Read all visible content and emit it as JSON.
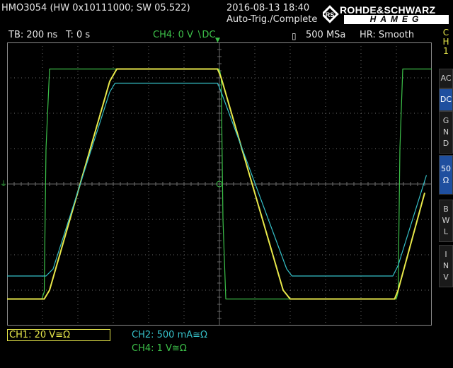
{
  "header": {
    "model_info": "HMO3054 (HW 0x10111000; SW 05.522)",
    "datetime": "2016-08-13 18:40",
    "status": "Auto-Trig./Complete",
    "brand_top": "ROHDE&SCHWARZ",
    "brand_bottom": "HAMEG"
  },
  "info_bar": {
    "timebase": "TB: 200 ns",
    "trigger_time": "T: 0 s",
    "trigger_channel": "CH4: 0 V ∖DC",
    "sample_rate": "500 MSa",
    "acq_mode": "HR: Smooth"
  },
  "side_menu": {
    "channel_label": [
      "C",
      "H",
      "1"
    ],
    "buttons": [
      {
        "id": "ac",
        "letters": [
          "AC"
        ],
        "active": false
      },
      {
        "id": "dc",
        "letters": [
          "DC"
        ],
        "active": true
      },
      {
        "id": "gnd",
        "letters": [
          "G",
          "N",
          "D"
        ],
        "active": false
      },
      {
        "id": "50ohm",
        "letters": [
          "50",
          "Ω"
        ],
        "active": true
      },
      {
        "id": "bwl",
        "letters": [
          "B",
          "W",
          "L"
        ],
        "active": false
      },
      {
        "id": "inv",
        "letters": [
          "I",
          "N",
          "V"
        ],
        "active": false
      }
    ]
  },
  "channels": {
    "ch1": "CH1: 20 V≅Ω",
    "ch2": "CH2: 500 mA≅Ω",
    "ch4": "CH4: 1 V≅Ω"
  },
  "colors": {
    "ch1": "#e8e84a",
    "ch2": "#35c0c8",
    "ch4": "#3dc24a",
    "grid": "#6a6a6a",
    "border": "#8a8a8a"
  },
  "markers": {
    "trigger_symbol": "▼",
    "ground_symbol": "⏚"
  },
  "chart_data": {
    "type": "line",
    "x_divisions": 12,
    "y_divisions": 8,
    "grid": true,
    "xlim": [
      -6,
      6
    ],
    "ylim": [
      -4,
      4
    ],
    "series": [
      {
        "name": "CH4",
        "color_key": "ch4",
        "x": [
          -6,
          -5.02,
          -4.95,
          -4.9,
          -4.8,
          0,
          0.05,
          0.1,
          0.18,
          5.0,
          5.05,
          5.1,
          5.18,
          6
        ],
        "y": [
          -3.25,
          -3.25,
          -3.05,
          1.0,
          3.25,
          3.25,
          3.0,
          -1.0,
          -3.25,
          -3.25,
          -3.05,
          1.0,
          3.25,
          3.25
        ]
      },
      {
        "name": "CH1",
        "color_key": "ch1",
        "x": [
          -6,
          -4.95,
          -4.8,
          -3.1,
          -2.9,
          -0.05,
          0.05,
          1.8,
          2.0,
          4.95,
          5.05,
          5.8
        ],
        "y": [
          -3.25,
          -3.25,
          -3.0,
          2.9,
          3.25,
          3.25,
          3.0,
          -3.0,
          -3.25,
          -3.25,
          -3.0,
          -0.25
        ]
      },
      {
        "name": "CH2",
        "color_key": "ch2",
        "x": [
          -6,
          -4.9,
          -4.7,
          -3.1,
          -2.95,
          -0.05,
          0.05,
          1.9,
          2.05,
          4.9,
          5.05,
          5.85
        ],
        "y": [
          -2.6,
          -2.6,
          -2.4,
          2.6,
          2.85,
          2.85,
          2.6,
          -2.4,
          -2.6,
          -2.6,
          -2.3,
          0.25
        ]
      }
    ]
  }
}
